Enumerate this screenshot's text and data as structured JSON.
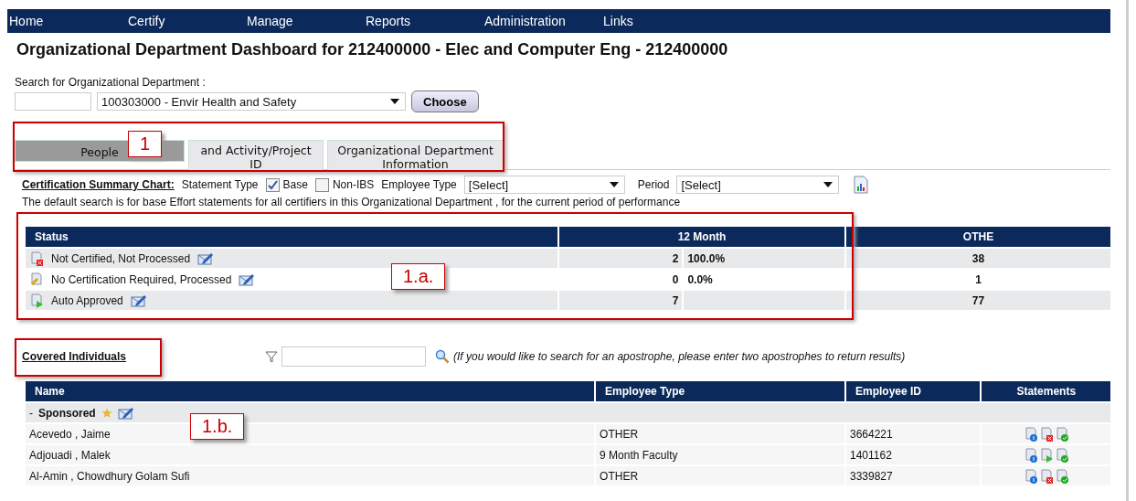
{
  "nav": [
    {
      "label": "Home"
    },
    {
      "label": "Certify"
    },
    {
      "label": "Manage"
    },
    {
      "label": "Reports"
    },
    {
      "label": "Administration"
    },
    {
      "label": "Links"
    }
  ],
  "title": "Organizational Department Dashboard for 212400000 - Elec and Computer Eng - 212400000",
  "department_search": {
    "label": "Search for Organizational Department :",
    "selected": "100303000 - Envir Health and Safety",
    "button": "Choose"
  },
  "tabs": [
    {
      "label": "People",
      "selected": true
    },
    {
      "label": "and Activity/Project ID",
      "selected": false
    },
    {
      "label": "Organizational Department Information",
      "selected": false
    }
  ],
  "summary": {
    "title": "Certification Summary Chart:",
    "statement_type_label": "Statement Type",
    "checkboxes": [
      {
        "label": "Base",
        "checked": true
      },
      {
        "label": "Non-IBS",
        "checked": false
      }
    ],
    "employee_type_label": "Employee Type",
    "employee_type": "[Select]",
    "period_label": "Period",
    "period": "[Select]",
    "note": "The default search is for base Effort statements for all certifiers in this Organizational Department , for the current period of performance"
  },
  "status_table": {
    "columns": [
      "Status",
      "12 Month",
      "OTHE"
    ],
    "rows": [
      {
        "kind": "rejected",
        "status": "Not Certified, Not Processed",
        "count": "2",
        "percent": "100.0%",
        "other": "38"
      },
      {
        "kind": "exempt",
        "status": "No Certification Required, Processed",
        "count": "0",
        "percent": "0.0%",
        "other": "1"
      },
      {
        "kind": "auto",
        "status": "Auto Approved",
        "count": "7",
        "other": "77"
      }
    ]
  },
  "covered": {
    "title": "Covered Individuals",
    "hint": "(If you would like to search for an apostrophe, please enter two apostrophes to return results)"
  },
  "people_table": {
    "columns": [
      "Name",
      "Employee Type",
      "Employee ID",
      "Statements"
    ],
    "group": "Sponsored",
    "group_marker": "-",
    "rows": [
      {
        "name": "Acevedo , Jaime",
        "type": "OTHER",
        "id": "3664221",
        "statements": [
          {
            "kind": "info"
          },
          {
            "kind": "rejected"
          },
          {
            "kind": "approved"
          }
        ]
      },
      {
        "name": "Adjouadi , Malek",
        "type": "9 Month Faculty",
        "id": "1401162",
        "statements": [
          {
            "kind": "info"
          },
          {
            "kind": "auto"
          },
          {
            "kind": "approved"
          }
        ]
      },
      {
        "name": "Al-Amin , Chowdhury Golam Sufi",
        "type": "OTHER",
        "id": "3339827",
        "statements": [
          {
            "kind": "info"
          },
          {
            "kind": "rejected"
          },
          {
            "kind": "approved"
          }
        ]
      }
    ]
  },
  "callouts": [
    {
      "label": "1",
      "kind": "tabs"
    },
    {
      "label": "1.a.",
      "kind": "status"
    },
    {
      "label": "1.b.",
      "kind": "people"
    }
  ]
}
